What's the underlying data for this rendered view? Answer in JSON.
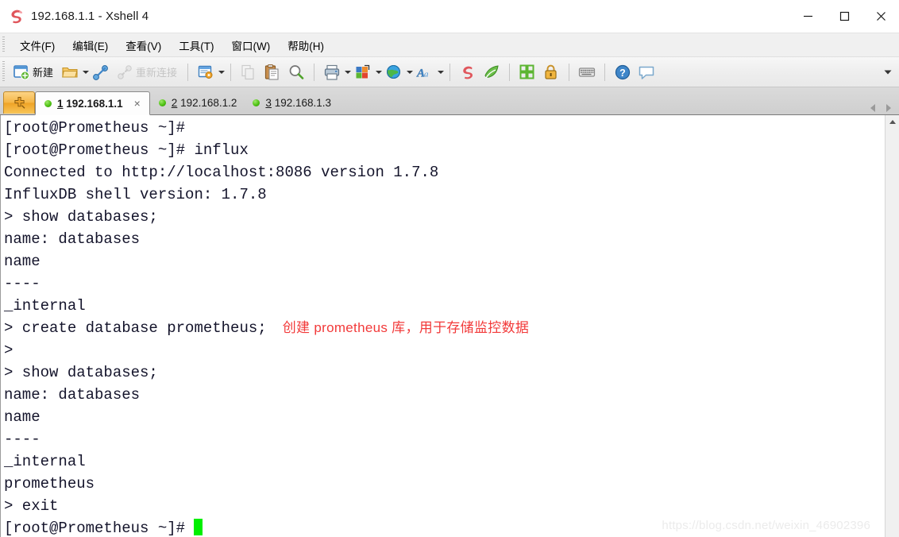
{
  "window": {
    "title": "192.168.1.1 - Xshell 4",
    "logo_icon": "xshell-logo-icon",
    "controls": {
      "minimize": "minimize-icon",
      "maximize": "maximize-icon",
      "close": "close-icon"
    }
  },
  "menubar": {
    "items": [
      {
        "label": "文件(F)",
        "name": "menu-file"
      },
      {
        "label": "编辑(E)",
        "name": "menu-edit"
      },
      {
        "label": "查看(V)",
        "name": "menu-view"
      },
      {
        "label": "工具(T)",
        "name": "menu-tools"
      },
      {
        "label": "窗口(W)",
        "name": "menu-window"
      },
      {
        "label": "帮助(H)",
        "name": "menu-help"
      }
    ]
  },
  "toolbar": {
    "new_label": "新建",
    "reconnect_label": "重新连接",
    "overflow_label": "toolbar-overflow-icon",
    "icons": [
      "new-session-icon",
      "open-folder-icon",
      "connect-icon",
      "disconnect-icon",
      "session-properties-icon",
      "copy-icon",
      "paste-icon",
      "find-icon",
      "print-icon",
      "layout-icon",
      "web-transfer-icon",
      "font-icon",
      "xshell-icon",
      "xftp-icon",
      "arrange-icon",
      "lock-icon",
      "keyboard-icon",
      "help-icon",
      "feedback-icon"
    ]
  },
  "tabbar": {
    "new_tab_label": "new-tab-icon",
    "tabs": [
      {
        "num": "1",
        "label": "192.168.1.1",
        "active": true,
        "status": "connected"
      },
      {
        "num": "2",
        "label": "192.168.1.2",
        "active": false,
        "status": "connected"
      },
      {
        "num": "3",
        "label": "192.168.1.3",
        "active": false,
        "status": "connected"
      }
    ],
    "close_label": "×",
    "nav_prev": "tab-scroll-left-icon",
    "nav_next": "tab-scroll-right-icon"
  },
  "terminal": {
    "lines": [
      {
        "text": "[root@Prometheus ~]#"
      },
      {
        "text": "[root@Prometheus ~]# influx"
      },
      {
        "text": "Connected to http://localhost:8086 version 1.7.8"
      },
      {
        "text": "InfluxDB shell version: 1.7.8"
      },
      {
        "text": "> show databases;"
      },
      {
        "text": "name: databases"
      },
      {
        "text": "name"
      },
      {
        "text": "----"
      },
      {
        "text": "_internal"
      },
      {
        "text": "> create database prometheus;",
        "annotation": "创建 prometheus 库，用于存储监控数据"
      },
      {
        "text": ">"
      },
      {
        "text": "> show databases;"
      },
      {
        "text": "name: databases"
      },
      {
        "text": "name"
      },
      {
        "text": "----"
      },
      {
        "text": "_internal"
      },
      {
        "text": "prometheus"
      },
      {
        "text": "> exit"
      },
      {
        "text": "[root@Prometheus ~]# ",
        "cursor": true
      }
    ],
    "watermark": "https://blog.csdn.net/weixin_46902396",
    "cursor_color": "#00ef00",
    "text_color": "#14142b",
    "annotation_color": "#f23a3a",
    "background": "#ffffff"
  },
  "scrollbar": {
    "up_arrow": "scroll-up-icon"
  }
}
